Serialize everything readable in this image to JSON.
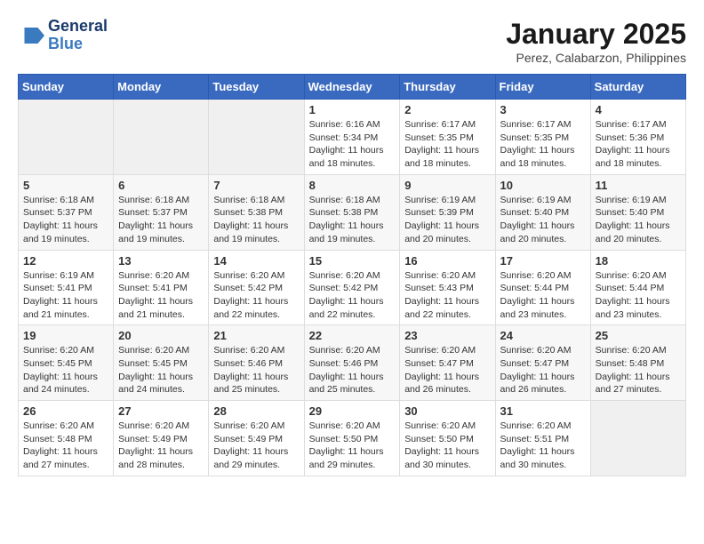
{
  "logo": {
    "line1": "General",
    "line2": "Blue"
  },
  "title": "January 2025",
  "subtitle": "Perez, Calabarzon, Philippines",
  "days_of_week": [
    "Sunday",
    "Monday",
    "Tuesday",
    "Wednesday",
    "Thursday",
    "Friday",
    "Saturday"
  ],
  "weeks": [
    [
      {
        "day": "",
        "info": ""
      },
      {
        "day": "",
        "info": ""
      },
      {
        "day": "",
        "info": ""
      },
      {
        "day": "1",
        "info": "Sunrise: 6:16 AM\nSunset: 5:34 PM\nDaylight: 11 hours\nand 18 minutes."
      },
      {
        "day": "2",
        "info": "Sunrise: 6:17 AM\nSunset: 5:35 PM\nDaylight: 11 hours\nand 18 minutes."
      },
      {
        "day": "3",
        "info": "Sunrise: 6:17 AM\nSunset: 5:35 PM\nDaylight: 11 hours\nand 18 minutes."
      },
      {
        "day": "4",
        "info": "Sunrise: 6:17 AM\nSunset: 5:36 PM\nDaylight: 11 hours\nand 18 minutes."
      }
    ],
    [
      {
        "day": "5",
        "info": "Sunrise: 6:18 AM\nSunset: 5:37 PM\nDaylight: 11 hours\nand 19 minutes."
      },
      {
        "day": "6",
        "info": "Sunrise: 6:18 AM\nSunset: 5:37 PM\nDaylight: 11 hours\nand 19 minutes."
      },
      {
        "day": "7",
        "info": "Sunrise: 6:18 AM\nSunset: 5:38 PM\nDaylight: 11 hours\nand 19 minutes."
      },
      {
        "day": "8",
        "info": "Sunrise: 6:18 AM\nSunset: 5:38 PM\nDaylight: 11 hours\nand 19 minutes."
      },
      {
        "day": "9",
        "info": "Sunrise: 6:19 AM\nSunset: 5:39 PM\nDaylight: 11 hours\nand 20 minutes."
      },
      {
        "day": "10",
        "info": "Sunrise: 6:19 AM\nSunset: 5:40 PM\nDaylight: 11 hours\nand 20 minutes."
      },
      {
        "day": "11",
        "info": "Sunrise: 6:19 AM\nSunset: 5:40 PM\nDaylight: 11 hours\nand 20 minutes."
      }
    ],
    [
      {
        "day": "12",
        "info": "Sunrise: 6:19 AM\nSunset: 5:41 PM\nDaylight: 11 hours\nand 21 minutes."
      },
      {
        "day": "13",
        "info": "Sunrise: 6:20 AM\nSunset: 5:41 PM\nDaylight: 11 hours\nand 21 minutes."
      },
      {
        "day": "14",
        "info": "Sunrise: 6:20 AM\nSunset: 5:42 PM\nDaylight: 11 hours\nand 22 minutes."
      },
      {
        "day": "15",
        "info": "Sunrise: 6:20 AM\nSunset: 5:42 PM\nDaylight: 11 hours\nand 22 minutes."
      },
      {
        "day": "16",
        "info": "Sunrise: 6:20 AM\nSunset: 5:43 PM\nDaylight: 11 hours\nand 22 minutes."
      },
      {
        "day": "17",
        "info": "Sunrise: 6:20 AM\nSunset: 5:44 PM\nDaylight: 11 hours\nand 23 minutes."
      },
      {
        "day": "18",
        "info": "Sunrise: 6:20 AM\nSunset: 5:44 PM\nDaylight: 11 hours\nand 23 minutes."
      }
    ],
    [
      {
        "day": "19",
        "info": "Sunrise: 6:20 AM\nSunset: 5:45 PM\nDaylight: 11 hours\nand 24 minutes."
      },
      {
        "day": "20",
        "info": "Sunrise: 6:20 AM\nSunset: 5:45 PM\nDaylight: 11 hours\nand 24 minutes."
      },
      {
        "day": "21",
        "info": "Sunrise: 6:20 AM\nSunset: 5:46 PM\nDaylight: 11 hours\nand 25 minutes."
      },
      {
        "day": "22",
        "info": "Sunrise: 6:20 AM\nSunset: 5:46 PM\nDaylight: 11 hours\nand 25 minutes."
      },
      {
        "day": "23",
        "info": "Sunrise: 6:20 AM\nSunset: 5:47 PM\nDaylight: 11 hours\nand 26 minutes."
      },
      {
        "day": "24",
        "info": "Sunrise: 6:20 AM\nSunset: 5:47 PM\nDaylight: 11 hours\nand 26 minutes."
      },
      {
        "day": "25",
        "info": "Sunrise: 6:20 AM\nSunset: 5:48 PM\nDaylight: 11 hours\nand 27 minutes."
      }
    ],
    [
      {
        "day": "26",
        "info": "Sunrise: 6:20 AM\nSunset: 5:48 PM\nDaylight: 11 hours\nand 27 minutes."
      },
      {
        "day": "27",
        "info": "Sunrise: 6:20 AM\nSunset: 5:49 PM\nDaylight: 11 hours\nand 28 minutes."
      },
      {
        "day": "28",
        "info": "Sunrise: 6:20 AM\nSunset: 5:49 PM\nDaylight: 11 hours\nand 29 minutes."
      },
      {
        "day": "29",
        "info": "Sunrise: 6:20 AM\nSunset: 5:50 PM\nDaylight: 11 hours\nand 29 minutes."
      },
      {
        "day": "30",
        "info": "Sunrise: 6:20 AM\nSunset: 5:50 PM\nDaylight: 11 hours\nand 30 minutes."
      },
      {
        "day": "31",
        "info": "Sunrise: 6:20 AM\nSunset: 5:51 PM\nDaylight: 11 hours\nand 30 minutes."
      },
      {
        "day": "",
        "info": ""
      }
    ]
  ]
}
